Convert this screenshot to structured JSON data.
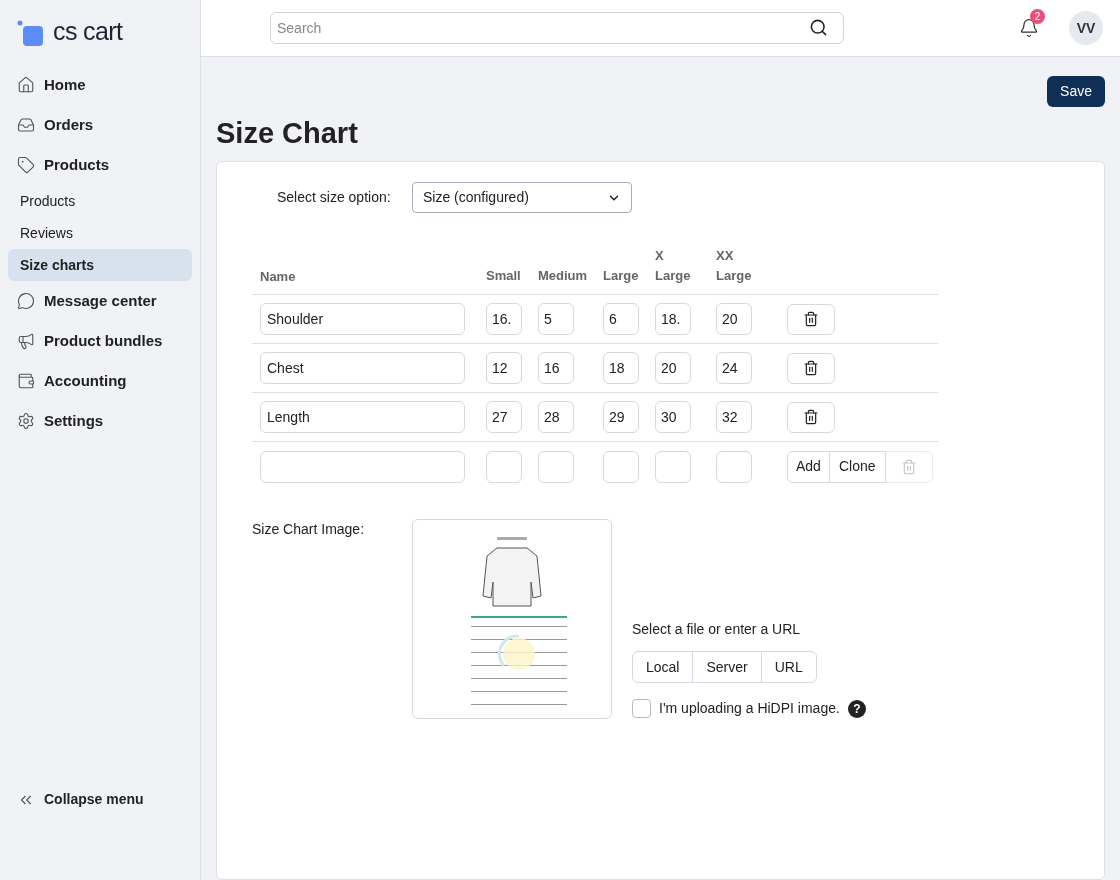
{
  "logo": "cs cart",
  "sidebar": {
    "items": [
      {
        "label": "Home",
        "kind": "main",
        "selected": false
      },
      {
        "label": "Orders",
        "kind": "main",
        "selected": false
      },
      {
        "label": "Products",
        "kind": "main",
        "selected": false
      },
      {
        "label": "Products",
        "kind": "sub",
        "selected": false
      },
      {
        "label": "Reviews",
        "kind": "sub",
        "selected": false
      },
      {
        "label": "Size charts",
        "kind": "sub",
        "selected": true
      },
      {
        "label": "Message center",
        "kind": "main",
        "selected": false
      },
      {
        "label": "Product bundles",
        "kind": "main",
        "selected": false
      },
      {
        "label": "Accounting",
        "kind": "main",
        "selected": false
      },
      {
        "label": "Settings",
        "kind": "main",
        "selected": false
      }
    ],
    "collapse": "Collapse menu"
  },
  "header": {
    "search": {
      "placeholder": "Search"
    },
    "notifications": "2",
    "avatar": "VV"
  },
  "save_button": "Save",
  "title": "Size Chart",
  "size_option": {
    "label": "Select size option:",
    "value": "Size (configured)"
  },
  "table": {
    "columns": [
      "Name",
      "Small",
      "Medium",
      "Large",
      "X Large",
      "XX Large"
    ],
    "rows": [
      {
        "name": "Shoulder",
        "values": [
          "16.",
          "5",
          "6",
          "18.",
          "20"
        ]
      },
      {
        "name": "Chest",
        "values": [
          "12",
          "16",
          "18",
          "20",
          "24"
        ]
      },
      {
        "name": "Length",
        "values": [
          "27",
          "28",
          "29",
          "30",
          "32"
        ]
      }
    ],
    "new_row": {
      "add": "Add",
      "clone": "Clone"
    }
  },
  "image": {
    "label": "Size Chart Image:",
    "kind": "picture"
  },
  "upload": {
    "prompt": "Select a file or enter a URL",
    "sources": [
      "Local",
      "Server",
      "URL"
    ],
    "hidpi": {
      "label": "I'm uploading a HiDPI image.",
      "checked": false
    },
    "help": "?"
  }
}
